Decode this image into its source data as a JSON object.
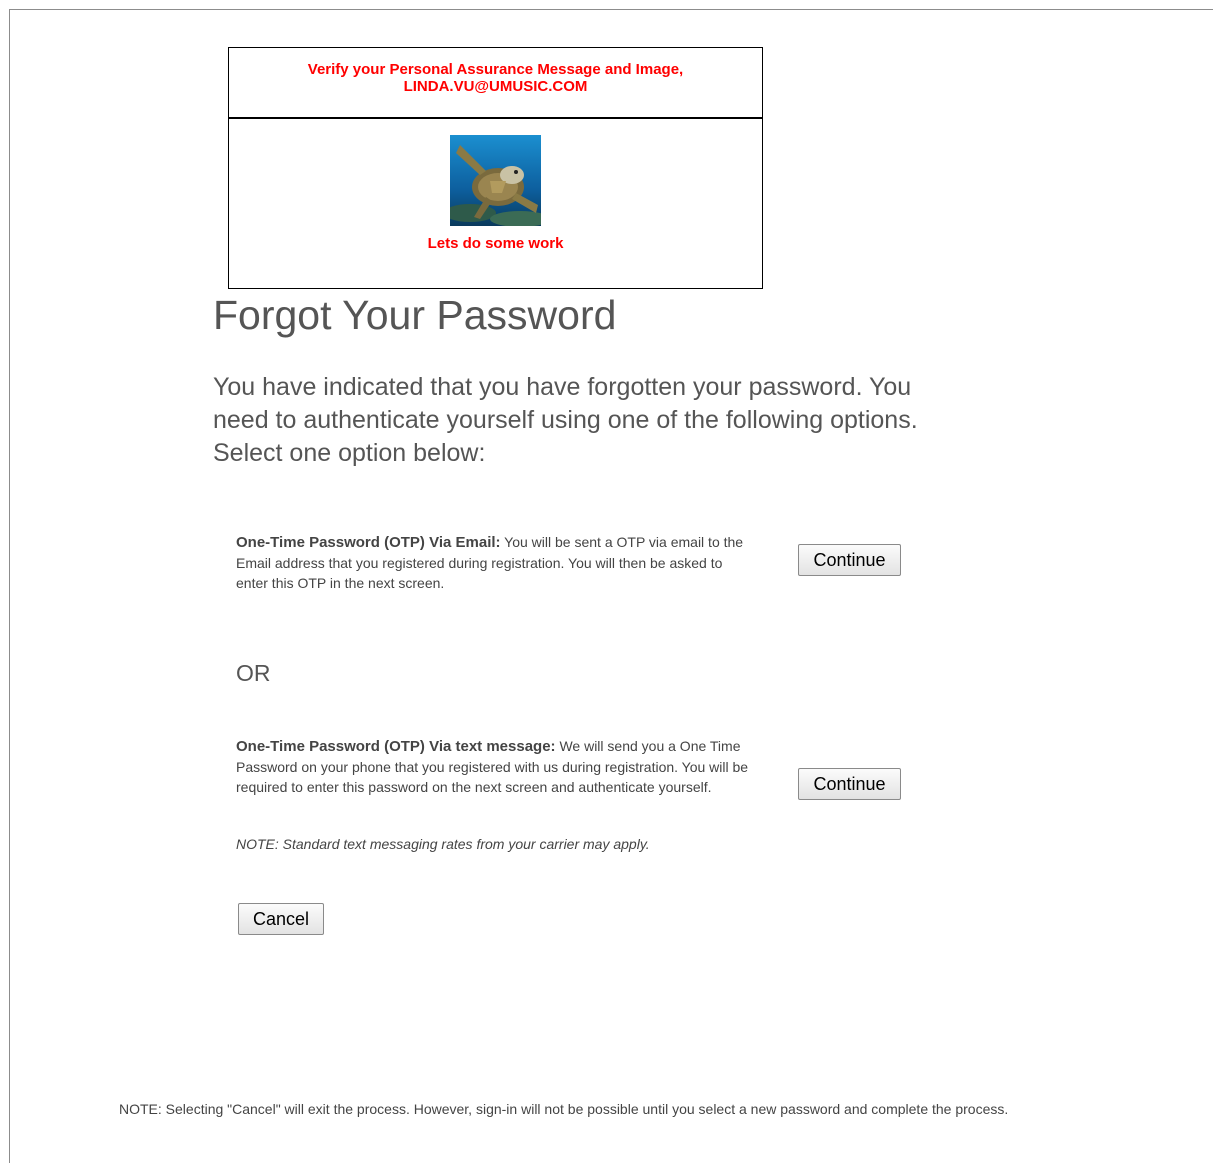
{
  "pam": {
    "heading": "Verify your Personal Assurance Message and Image,",
    "user_email": "LINDA.VU@UMUSIC.COM",
    "image_alt": "sea turtle",
    "message": "Lets do some work"
  },
  "page": {
    "title": "Forgot Your Password",
    "intro": "You have indicated that you have forgotten your password. You need to authenticate yourself using one of the following options. Select one option below:"
  },
  "options": {
    "email": {
      "title": "One-Time Password (OTP) Via Email:",
      "description": " You will be sent a OTP via email to the Email address that you registered during registration. You will then be asked to enter this OTP in the next screen.",
      "button_label": "Continue"
    },
    "separator": "OR",
    "text": {
      "title": "One-Time Password (OTP) Via text message:",
      "description": " We will send you a One Time Password on your phone that you registered with us during registration. You will be required to enter this password on the next screen and authenticate yourself.",
      "note": "NOTE: Standard text messaging rates from your carrier may apply.",
      "button_label": "Continue"
    }
  },
  "actions": {
    "cancel_label": "Cancel"
  },
  "footer": {
    "note": "NOTE: Selecting \"Cancel\" will exit the process. However, sign-in will not be possible until you select a new password and complete the process."
  }
}
